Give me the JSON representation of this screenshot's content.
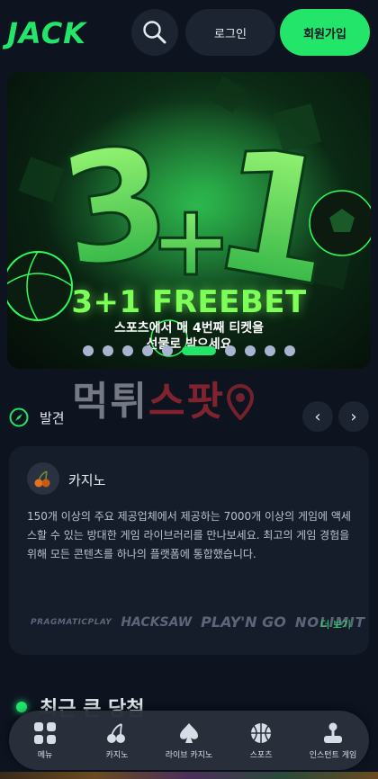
{
  "header": {
    "logo": "JACK",
    "login_label": "로그인",
    "signup_label": "회원가입"
  },
  "banner": {
    "big_text": "3+1",
    "title": "3+1 FREEBET",
    "subtitle_line1": "스포츠에서 매 4번째 티켓을",
    "subtitle_line2": "선물로 받으세요",
    "slide_count": 10,
    "active_slide": 5
  },
  "watermark": {
    "part1": "먹튀",
    "part2": "스팟"
  },
  "discover": {
    "label": "발견",
    "prev": "‹",
    "next": "›"
  },
  "casino_card": {
    "title": "카지노",
    "description": "150개 이상의 주요 제공업체에서 제공하는 7000개 이상의 게임에 액세스할 수 있는 방대한 게임 라이브러리를 만나보세요. 최고의 게임 경험을 위해 모든 콘텐츠를 하나의 플랫폼에 통합했습니다.",
    "providers": [
      "PRAGMATICPLAY",
      "HACKSAW",
      "PLAY'N GO",
      "NOLIMIT"
    ],
    "more_label": "더 보기"
  },
  "recent": {
    "title": "최근 큰 당첨"
  },
  "bottom_nav": [
    {
      "label": "메뉴",
      "icon": "menu-grid-icon"
    },
    {
      "label": "카지노",
      "icon": "cherry-icon"
    },
    {
      "label": "라이브 카지노",
      "icon": "spade-icon"
    },
    {
      "label": "스포츠",
      "icon": "basketball-icon"
    },
    {
      "label": "인스턴트 게임",
      "icon": "joystick-icon"
    }
  ],
  "colors": {
    "accent": "#22e56a",
    "background": "#0d1420",
    "surface": "#151d2b"
  }
}
